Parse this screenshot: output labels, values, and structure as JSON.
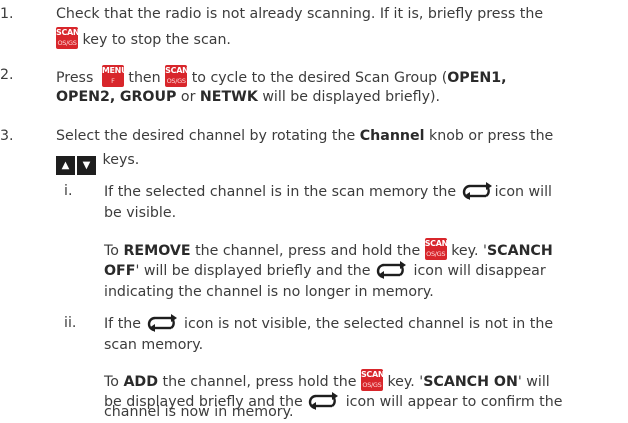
{
  "steps": {
    "s1": {
      "num": "1.",
      "l1": "Check that the radio is not already scanning. If it is, briefly press the",
      "l2_after": "key to stop the scan."
    },
    "s2": {
      "num": "2.",
      "l1_press": "Press",
      "l1_then": "then",
      "l1_rest": "to cycle to the desired Scan Group (",
      "open1": "OPEN1,",
      "open2": "OPEN2,",
      "group": "GROUP",
      "or": "or",
      "netwk": "NETWK",
      "l2_rest": "will be displayed briefly)."
    },
    "s3": {
      "num": "3.",
      "l1_pre": "Select the desired channel by rotating the",
      "channel": "Channel",
      "l1_post": "knob or press the",
      "l2_after": "keys."
    },
    "sub_i": {
      "num": "i.",
      "l1": "If the selected channel is in the scan memory the",
      "l1_after": "icon will",
      "l2": "be visible.",
      "p2_to": "To",
      "remove": "REMOVE",
      "p2_mid": "the channel, press and hold the",
      "p2_key": "key. '",
      "scanch": "SCANCH",
      "off": "OFF",
      "p3_rest": "' will be displayed briefly and the",
      "p3_after": "icon will disappear",
      "p4": "indicating the channel is no longer in memory."
    },
    "sub_ii": {
      "num": "ii.",
      "l1_pre": "If the",
      "l1_post": "icon is not visible, the selected channel is not in the",
      "l2": "scan memory.",
      "p2_to": "To",
      "add": "ADD",
      "p2_mid": "the channel, press hold the",
      "p2_key": "key. '",
      "scanch_on": "SCANCH ON",
      "p2_end": "' will",
      "p3_pre": "be displayed briefly and the",
      "p3_post": "icon will appear to confirm the",
      "p4": "channel is now in memory."
    }
  },
  "keys": {
    "scan": {
      "top": "SCAN",
      "bottom": "OS/GS",
      "icon": "scan-key-icon"
    },
    "menu": {
      "top": "MENU",
      "bottom": "F",
      "icon": "menu-key-icon"
    },
    "up": "▲",
    "down": "▼"
  },
  "colors": {
    "key_red": "#d8262b",
    "arrow_key": "#1e1e1e",
    "text": "#3c3c3c"
  }
}
